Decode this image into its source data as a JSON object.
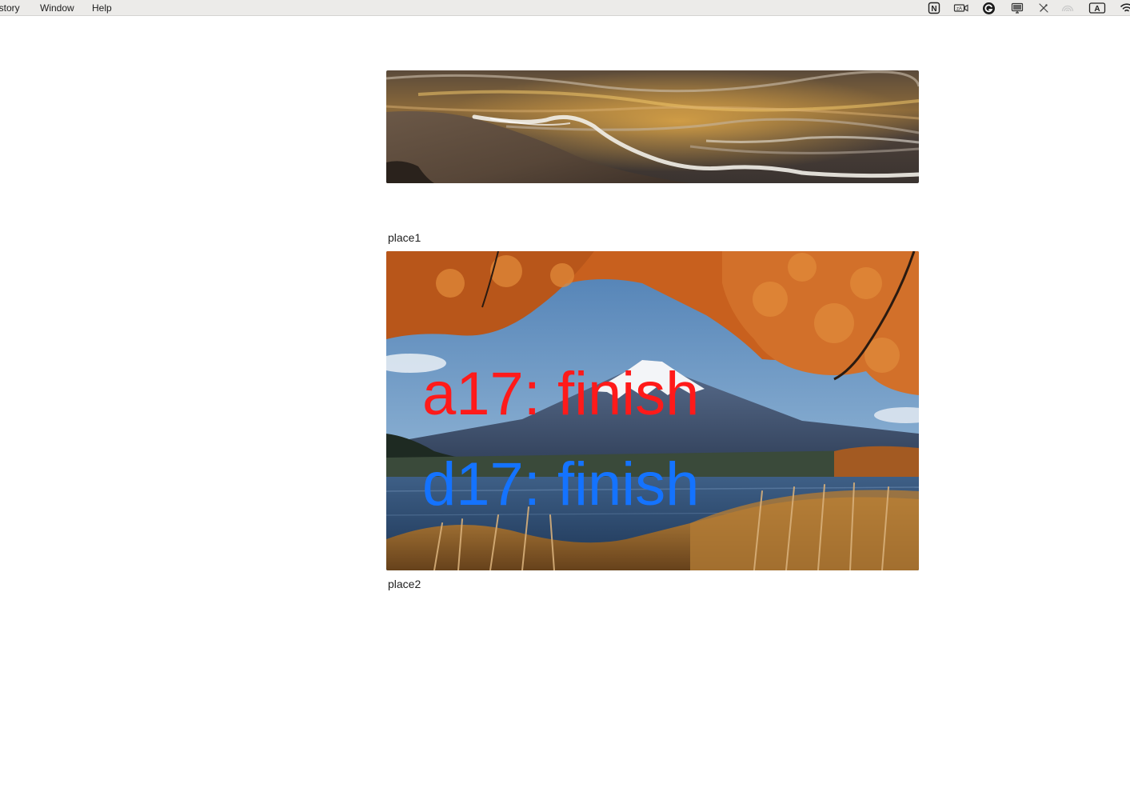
{
  "menubar": {
    "items": [
      {
        "label": "istory"
      },
      {
        "label": "Window"
      },
      {
        "label": "Help"
      }
    ],
    "status_icons": [
      "notion-icon",
      "screen-record-icon",
      "grammarly-icon",
      "display-icon",
      "pen-off-icon",
      "airdrop-icon",
      "keyboard-input-icon",
      "wifi-icon"
    ],
    "input_source_label": "A",
    "notion_letter": "N"
  },
  "content": {
    "images": [
      {
        "name": "beach-waves-image",
        "caption": "place1"
      },
      {
        "name": "mount-fuji-image",
        "caption": "place2"
      }
    ],
    "overlays": [
      {
        "text": "a17: finish",
        "color": "#ff1a1a"
      },
      {
        "text": "d17: finish",
        "color": "#1473ff"
      }
    ]
  }
}
